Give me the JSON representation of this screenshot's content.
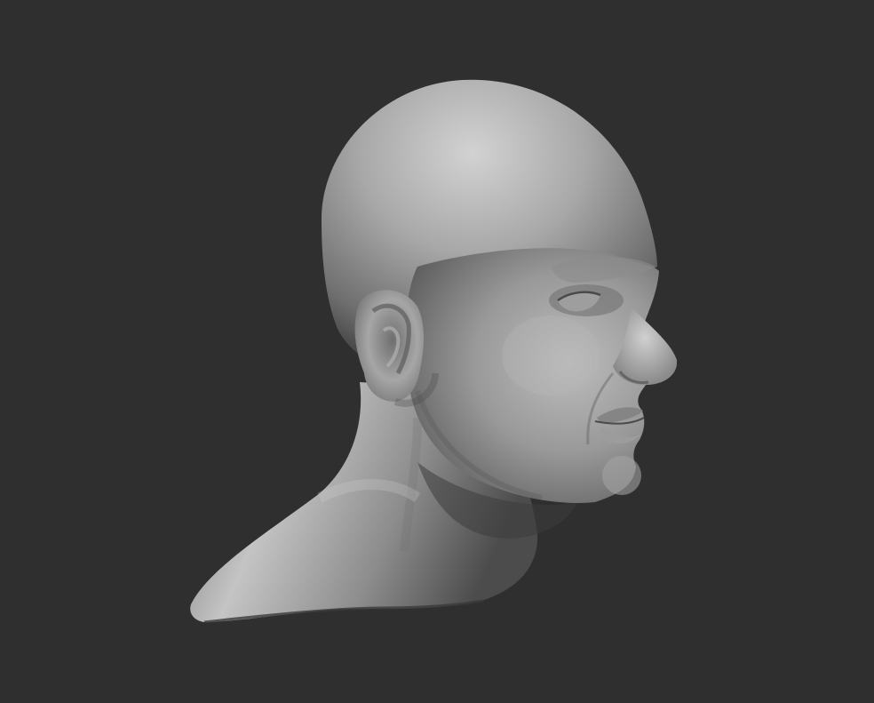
{
  "viewport": {
    "background_color": "#2f2f2f"
  },
  "sculpt": {
    "subject": "sculpted-male-head-bust",
    "material_color": "#9a9a9a",
    "highlight_color": "#c8c8c8",
    "shadow_color": "#3a3a3a"
  }
}
